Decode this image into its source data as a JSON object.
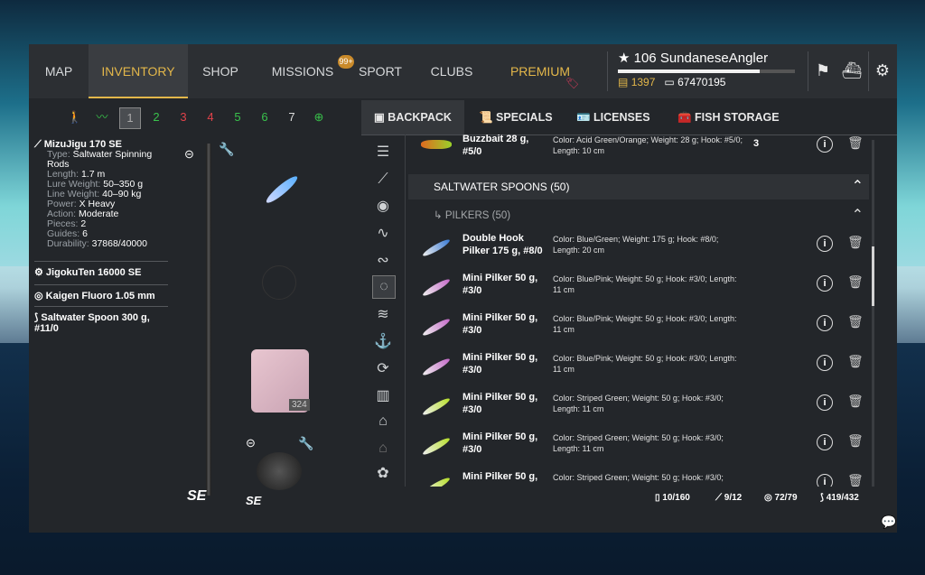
{
  "nav": {
    "items": [
      "MAP",
      "INVENTORY",
      "SHOP",
      "MISSIONS",
      "SPORT",
      "CLUBS",
      "PREMIUM"
    ],
    "missions_badge": "99+"
  },
  "player": {
    "level_name": "106 SundaneseAngler",
    "gold": "1397",
    "silver": "67470195",
    "xp_fraction": 0.8
  },
  "slots": [
    "1",
    "2",
    "3",
    "4",
    "5",
    "6",
    "7"
  ],
  "rod": {
    "title": "MizuJigu 170 SE",
    "type_label": "Type:",
    "type": "Saltwater Spinning Rods",
    "length_label": "Length:",
    "length": "1.7 m",
    "lure_weight_label": "Lure Weight:",
    "lure_weight": "50–350 g",
    "line_weight_label": "Line Weight:",
    "line_weight": "40–90 kg",
    "power_label": "Power:",
    "power": "X Heavy",
    "action_label": "Action:",
    "action": "Moderate",
    "pieces_label": "Pieces:",
    "pieces": "2",
    "guides_label": "Guides:",
    "guides": "6",
    "durability_label": "Durability:",
    "durability": "37868/40000"
  },
  "equipment": {
    "reel": "JigokuTen 16000 SE",
    "line": "Kaigen Fluoro 1.05 mm",
    "lure": "Saltwater Spoon 300 g, #11/0",
    "line_count": "324",
    "rod_logo": "SE",
    "reel_logo": "SE"
  },
  "tabs": [
    "BACKPACK",
    "SPECIALS",
    "LICENSES",
    "FISH STORAGE"
  ],
  "list": {
    "top_item": {
      "name": "Buzzbait 28 g, #5/0",
      "desc": "Color: Acid Green/Orange; Weight: 28 g; Hook: #5/0; Length: 10 cm",
      "qty": "3"
    },
    "section": "SALTWATER SPOONS (50)",
    "subsection": "PILKERS (50)",
    "items": [
      {
        "name": "Double Hook Pilker 175 g, #8/0",
        "desc": "Color: Blue/Green; Weight: 175 g; Hook: #8/0; Length: 20 cm",
        "color": "#3a7bd5"
      },
      {
        "name": "Mini Pilker 50 g, #3/0",
        "desc": "Color: Blue/Pink; Weight: 50 g; Hook: #3/0; Length: 11 cm",
        "color": "#c56ac9"
      },
      {
        "name": "Mini Pilker 50 g, #3/0",
        "desc": "Color: Blue/Pink; Weight: 50 g; Hook: #3/0; Length: 11 cm",
        "color": "#c56ac9"
      },
      {
        "name": "Mini Pilker 50 g, #3/0",
        "desc": "Color: Blue/Pink; Weight: 50 g; Hook: #3/0; Length: 11 cm",
        "color": "#c56ac9"
      },
      {
        "name": "Mini Pilker 50 g, #3/0",
        "desc": "Color: Striped Green; Weight: 50 g; Hook: #3/0; Length: 11 cm",
        "color": "#b8e02a"
      },
      {
        "name": "Mini Pilker 50 g, #3/0",
        "desc": "Color: Striped Green; Weight: 50 g; Hook: #3/0; Length: 11 cm",
        "color": "#b8e02a"
      },
      {
        "name": "Mini Pilker 50 g,",
        "desc": "Color: Striped Green; Weight: 50 g; Hook: #3/0;",
        "color": "#b8e02a"
      }
    ]
  },
  "footer": {
    "backpack": "10/160",
    "rods": "9/12",
    "reels": "72/79",
    "baits": "419/432"
  },
  "icons": {
    "info": "i",
    "trash": "🗑"
  }
}
